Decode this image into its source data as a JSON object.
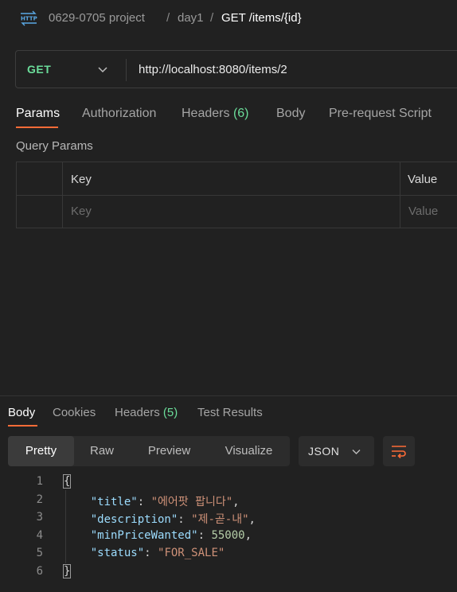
{
  "breadcrumb": {
    "icon": "http-icon",
    "collection": "0629-0705 project",
    "separator": "/",
    "folder": "day1",
    "request": "GET /items/{id}"
  },
  "request": {
    "method": "GET",
    "url": "http://localhost:8080/items/2"
  },
  "request_tabs": [
    {
      "label": "Params",
      "active": true
    },
    {
      "label": "Authorization"
    },
    {
      "label": "Headers",
      "count": "(6)"
    },
    {
      "label": "Body"
    },
    {
      "label": "Pre-request Script"
    }
  ],
  "query_params": {
    "title": "Query Params",
    "columns": [
      "Key",
      "Value"
    ],
    "placeholders": [
      "Key",
      "Value"
    ]
  },
  "response_tabs": [
    {
      "label": "Body",
      "active": true
    },
    {
      "label": "Cookies"
    },
    {
      "label": "Headers",
      "count": "(5)"
    },
    {
      "label": "Test Results"
    }
  ],
  "view_modes": [
    "Pretty",
    "Raw",
    "Preview",
    "Visualize"
  ],
  "active_view": "Pretty",
  "format": "JSON",
  "code": {
    "line_numbers": [
      "1",
      "2",
      "3",
      "4",
      "5",
      "6"
    ],
    "open_brace": "{",
    "close_brace": "}",
    "fields": [
      {
        "key": "\"title\"",
        "value": "\"에어팟 팝니다\"",
        "type": "string",
        "comma": true
      },
      {
        "key": "\"description\"",
        "value": "\"제-곧-내\"",
        "type": "string",
        "comma": true
      },
      {
        "key": "\"minPriceWanted\"",
        "value": "55000",
        "type": "number",
        "comma": true
      },
      {
        "key": "\"status\"",
        "value": "\"FOR_SALE\"",
        "type": "string",
        "comma": false
      }
    ]
  },
  "colors": {
    "accent": "#ff6c37",
    "method_get": "#6bdd9a",
    "count": "#6bdd9a",
    "json_key": "#9cdcfe",
    "json_string": "#ce9178",
    "json_number": "#b5cea8"
  }
}
